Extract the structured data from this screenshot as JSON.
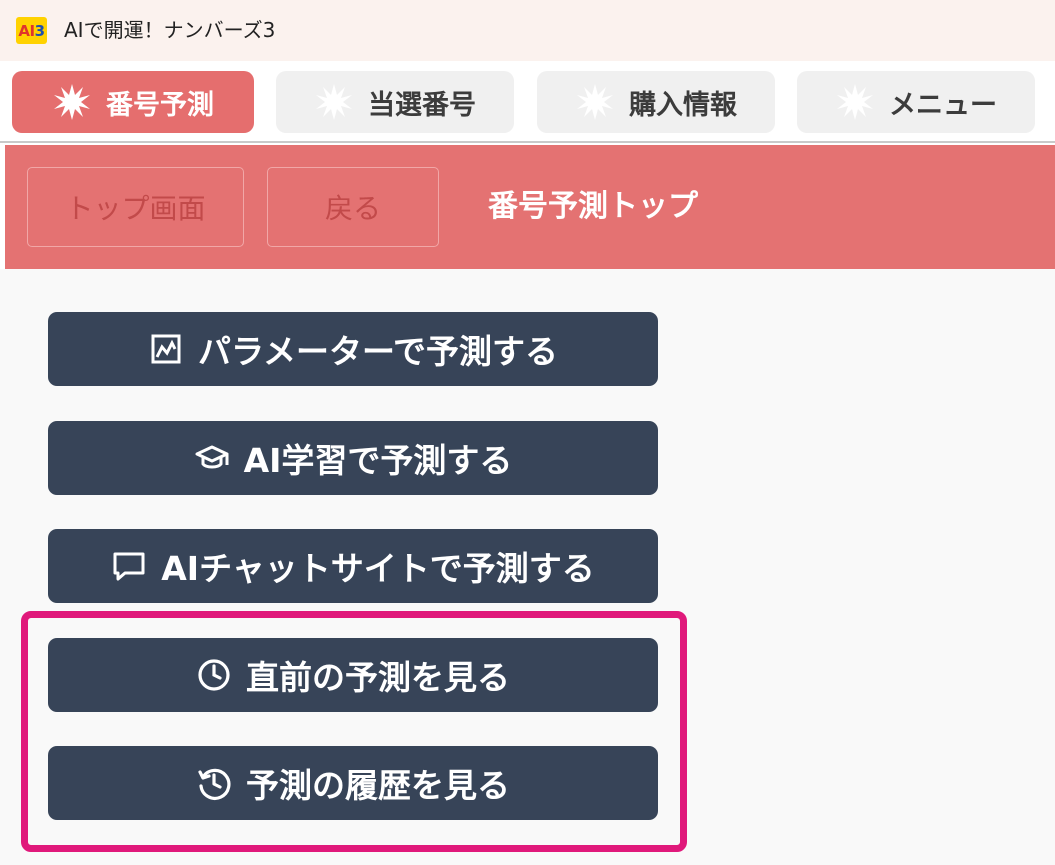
{
  "window": {
    "logo_text_a": "AI",
    "logo_text_b": "3",
    "title": "AIで開運！ナンバーズ3"
  },
  "tabs": [
    {
      "label": "番号予測",
      "icon": "burst-icon",
      "active": true
    },
    {
      "label": "当選番号",
      "icon": "burst-icon",
      "active": false
    },
    {
      "label": "購入情報",
      "icon": "burst-icon",
      "active": false
    },
    {
      "label": "メニュー",
      "icon": "burst-icon",
      "active": false
    }
  ],
  "header": {
    "top_button": "トップ画面",
    "back_button": "戻る",
    "title": "番号予測トップ"
  },
  "actions": [
    {
      "label": "パラメーターで予測する",
      "icon": "chart-frame-icon"
    },
    {
      "label": "AI学習で予測する",
      "icon": "graduation-cap-icon"
    },
    {
      "label": "AIチャットサイトで予測する",
      "icon": "chat-bubble-icon"
    },
    {
      "label": "直前の予測を見る",
      "icon": "clock-icon"
    },
    {
      "label": "予測の履歴を見る",
      "icon": "history-icon"
    }
  ],
  "colors": {
    "accent": "#e47272",
    "button": "#374458",
    "highlight": "#e0197b"
  }
}
